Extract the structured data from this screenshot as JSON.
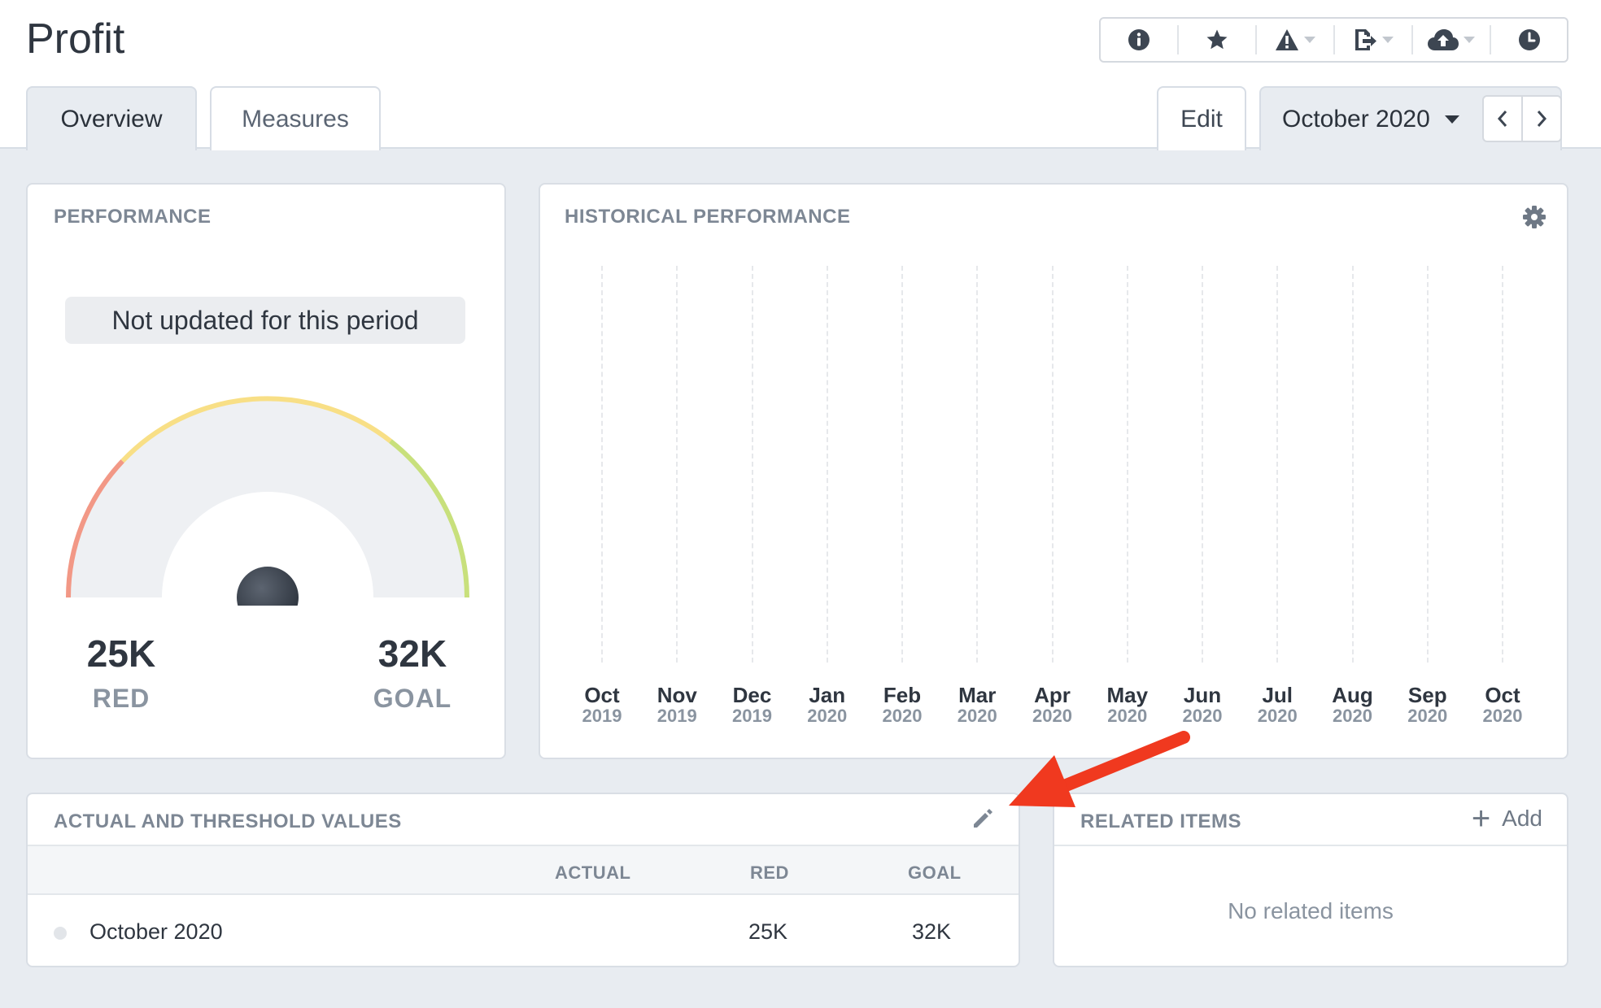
{
  "header": {
    "title": "Profit"
  },
  "toolbar": {
    "buttons": [
      "info-icon",
      "star-icon",
      "warning-icon",
      "export-icon",
      "cloud-upload-icon",
      "clock-icon"
    ]
  },
  "tabs": {
    "overview": "Overview",
    "measures": "Measures",
    "edit": "Edit",
    "period": "October 2020"
  },
  "performance": {
    "title": "PERFORMANCE",
    "notice": "Not updated for this period",
    "red_value": "25K",
    "red_label": "RED",
    "goal_value": "32K",
    "goal_label": "GOAL",
    "colors": {
      "red": "#f29886",
      "yellow": "#f8df86",
      "green": "#c8e07c"
    }
  },
  "historical": {
    "title": "HISTORICAL PERFORMANCE",
    "months": [
      {
        "m": "Oct",
        "y": "2019"
      },
      {
        "m": "Nov",
        "y": "2019"
      },
      {
        "m": "Dec",
        "y": "2019"
      },
      {
        "m": "Jan",
        "y": "2020"
      },
      {
        "m": "Feb",
        "y": "2020"
      },
      {
        "m": "Mar",
        "y": "2020"
      },
      {
        "m": "Apr",
        "y": "2020"
      },
      {
        "m": "May",
        "y": "2020"
      },
      {
        "m": "Jun",
        "y": "2020"
      },
      {
        "m": "Jul",
        "y": "2020"
      },
      {
        "m": "Aug",
        "y": "2020"
      },
      {
        "m": "Sep",
        "y": "2020"
      },
      {
        "m": "Oct",
        "y": "2020"
      }
    ]
  },
  "values_table": {
    "title": "ACTUAL AND THRESHOLD VALUES",
    "columns": {
      "actual": "ACTUAL",
      "red": "RED",
      "goal": "GOAL"
    },
    "rows": [
      {
        "period": "October 2020",
        "actual": "",
        "red": "25K",
        "goal": "32K"
      }
    ]
  },
  "related": {
    "title": "RELATED ITEMS",
    "add_label": "Add",
    "empty": "No related items"
  },
  "annotation": {
    "arrow_color": "#f0391f"
  }
}
